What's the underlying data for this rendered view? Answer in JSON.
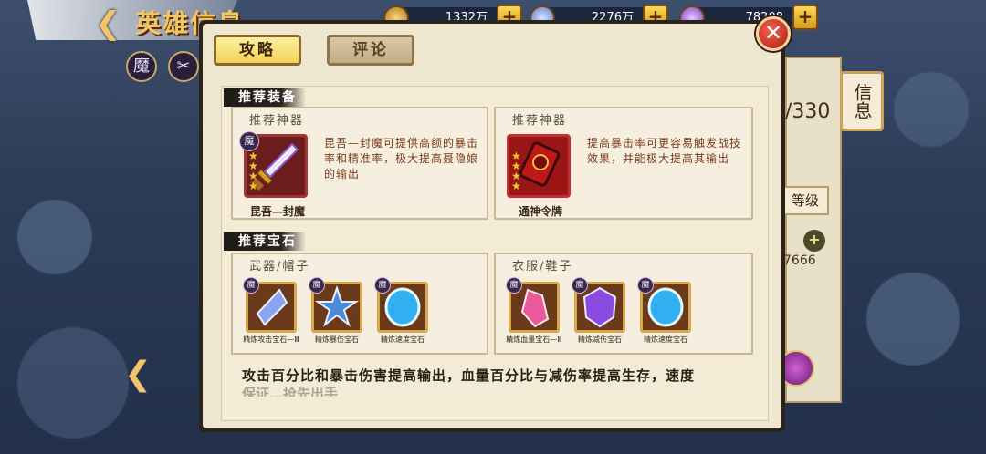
{
  "page_title": "英雄信息",
  "resources": [
    {
      "name": "gold-coin",
      "value": "1332万"
    },
    {
      "name": "silver",
      "value": "2276万"
    },
    {
      "name": "gem",
      "value": "78208"
    }
  ],
  "hero_badges": {
    "element": "魔"
  },
  "background_panel": {
    "info_tab": "信息",
    "level_text": "/330",
    "grade_button": "等级",
    "number": "7666",
    "skill_count": "3"
  },
  "dialog": {
    "tabs": [
      {
        "label": "攻略",
        "active": true
      },
      {
        "label": "评论",
        "active": false
      }
    ],
    "close_label": "✕",
    "sections": {
      "equipment": {
        "header": "推荐装备",
        "cards": [
          {
            "title": "推荐神器",
            "item_name": "昆吾—封魔",
            "badge": "魔",
            "description": "昆吾—封魔可提供高额的暴击率和精准率，极大提高聂隐娘的输出"
          },
          {
            "title": "推荐神器",
            "item_name": "通神令牌",
            "badge": "",
            "description": "提高暴击率可更容易触发战技效果，并能极大提高其输出"
          }
        ]
      },
      "gems": {
        "header": "推荐宝石",
        "groups": [
          {
            "title": "武器/帽子",
            "gems": [
              {
                "badge": "魔",
                "label": "精炼攻击宝石—Ⅲ",
                "color": "#8aa4f0"
              },
              {
                "badge": "魔",
                "label": "精炼暴伤宝石",
                "color": "#4a8ad8"
              },
              {
                "badge": "魔",
                "label": "精炼速度宝石",
                "color": "#30b0f0"
              }
            ]
          },
          {
            "title": "衣服/鞋子",
            "gems": [
              {
                "badge": "魔",
                "label": "精炼血量宝石—Ⅲ",
                "color": "#e85a9a"
              },
              {
                "badge": "魔",
                "label": "精炼减伤宝石",
                "color": "#8a4ae0"
              },
              {
                "badge": "魔",
                "label": "精炼速度宝石",
                "color": "#30b0f0"
              }
            ]
          }
        ]
      }
    },
    "summary_line1": "攻击百分比和暴击伤害提高输出，血量百分比与减伤率提高生存，速度",
    "summary_line2": "保证…抢先出手"
  }
}
